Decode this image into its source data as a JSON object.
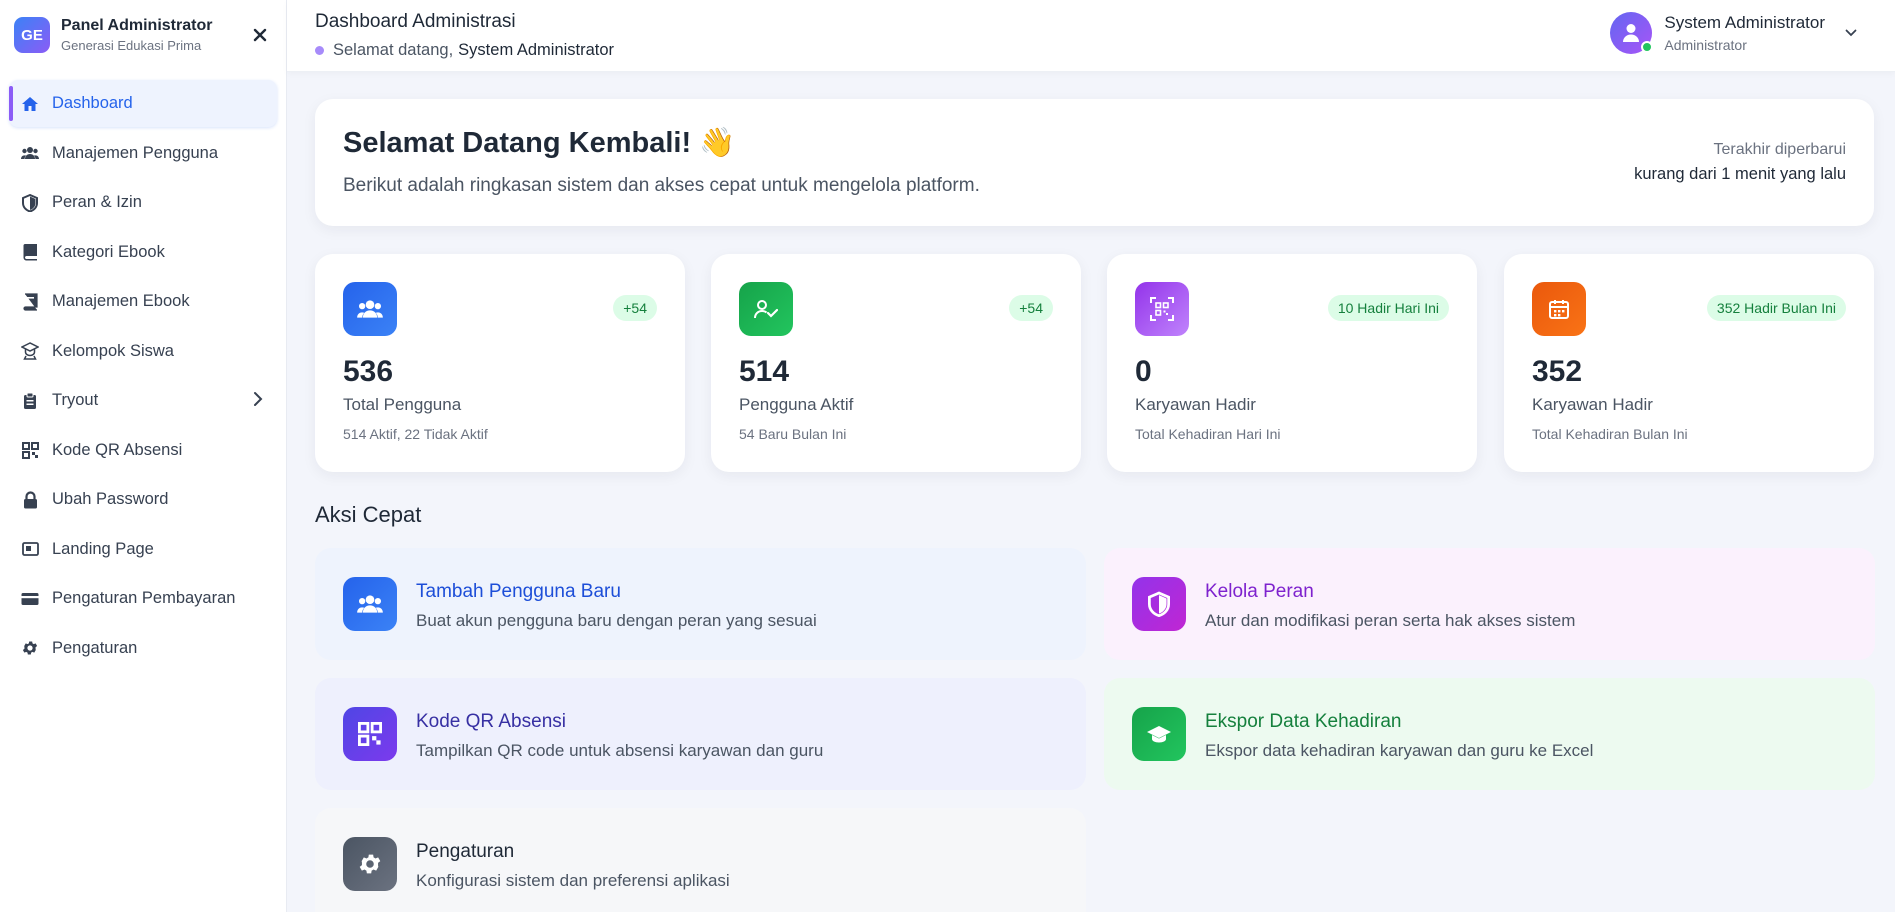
{
  "sidebar": {
    "logo_text": "GE",
    "title": "Panel Administrator",
    "subtitle": "Generasi Edukasi Prima",
    "close_icon": "close-icon",
    "items": [
      {
        "label": "Dashboard",
        "icon": "home-icon"
      },
      {
        "label": "Manajemen Pengguna",
        "icon": "users-icon"
      },
      {
        "label": "Peran & Izin",
        "icon": "shield-icon"
      },
      {
        "label": "Kategori Ebook",
        "icon": "book-icon"
      },
      {
        "label": "Manajemen Ebook",
        "icon": "book-open-icon"
      },
      {
        "label": "Kelompok Siswa",
        "icon": "graduate-icon"
      },
      {
        "label": "Tryout",
        "icon": "clipboard-icon"
      },
      {
        "label": "Kode QR Absensi",
        "icon": "qr-icon"
      },
      {
        "label": "Ubah Password",
        "icon": "lock-icon"
      },
      {
        "label": "Landing Page",
        "icon": "page-icon"
      },
      {
        "label": "Pengaturan Pembayaran",
        "icon": "card-icon"
      },
      {
        "label": "Pengaturan",
        "icon": "gear-icon"
      }
    ]
  },
  "header": {
    "title": "Dashboard Administrasi",
    "welcome_prefix": "Selamat datang,",
    "welcome_name": "System Administrator",
    "user_name": "System Administrator",
    "user_role": "Administrator"
  },
  "welcome": {
    "title": "Selamat Datang Kembali!",
    "emoji": "👋",
    "subtitle": "Berikut adalah ringkasan sistem dan akses cepat untuk mengelola platform.",
    "updated_label": "Terakhir diperbarui",
    "updated_value": "kurang dari 1 menit yang lalu"
  },
  "stats": [
    {
      "value": "536",
      "label": "Total Pengguna",
      "note": "514 Aktif, 22 Tidak Aktif",
      "badge": "+54",
      "icon": "users-icon",
      "color": "#3b82f6"
    },
    {
      "value": "514",
      "label": "Pengguna Aktif",
      "note": "54 Baru Bulan Ini",
      "badge": "+54",
      "icon": "user-check-icon",
      "color": "#22c55e"
    },
    {
      "value": "0",
      "label": "Karyawan Hadir",
      "note": "Total Kehadiran Hari Ini",
      "badge": "10 Hadir Hari Ini",
      "icon": "qr-scan-icon",
      "color": "#a855f7"
    },
    {
      "value": "352",
      "label": "Karyawan Hadir",
      "note": "Total Kehadiran Bulan Ini",
      "badge": "352 Hadir Bulan Ini",
      "icon": "calendar-icon",
      "color": "#f97316"
    }
  ],
  "quick_actions": {
    "title": "Aksi Cepat",
    "items": [
      {
        "title": "Tambah Pengguna Baru",
        "desc": "Buat akun pengguna baru dengan peran yang sesuai",
        "icon": "users-icon"
      },
      {
        "title": "Kelola Peran",
        "desc": "Atur dan modifikasi peran serta hak akses sistem",
        "icon": "shield-icon"
      },
      {
        "title": "Kode QR Absensi",
        "desc": "Tampilkan QR code untuk absensi karyawan dan guru",
        "icon": "qr-icon"
      },
      {
        "title": "Ekspor Data Kehadiran",
        "desc": "Ekspor data kehadiran karyawan dan guru ke Excel",
        "icon": "graduate-icon"
      },
      {
        "title": "Pengaturan",
        "desc": "Konfigurasi sistem dan preferensi aplikasi",
        "icon": "gear-icon"
      }
    ]
  }
}
